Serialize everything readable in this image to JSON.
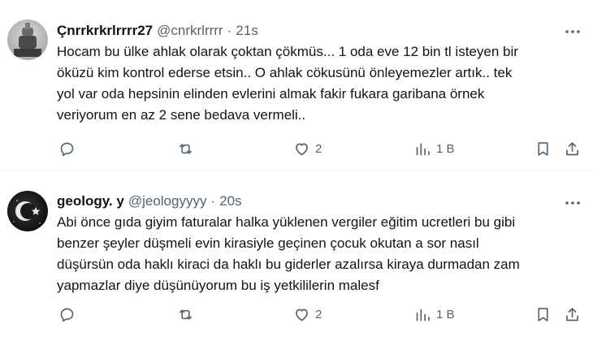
{
  "tweets": [
    {
      "display_name": "Çnrrkrkrlrrrr27",
      "handle": "@cnrkrlrrrr",
      "separator": "·",
      "time": "21s",
      "text": "Hocam bu ülke ahlak olarak çoktan çökmüs... 1 oda eve 12 bin tl isteyen bir\nöküzü kim kontrol ederse etsin..  O ahlak cökusünü önleyemezler artık..  tek\nyol var oda hepsinin elinden evlerini almak fakir fukara garibana örnek\nveriyorum en az 2 sene bedava vermeli..",
      "reply_count": "",
      "retweet_count": "",
      "like_count": "2",
      "view_count": "1 B"
    },
    {
      "display_name": "geology. y",
      "handle": "@jeologyyyy",
      "separator": "·",
      "time": "20s",
      "text": "Abi önce gıda giyim faturalar halka yüklenen vergiler eğitim ucretleri bu gibi\nbenzer şeyler düşmeli evin kirasiyle geçinen çocuk okutan a sor nasıl\ndüşürsün oda haklı kiraci da haklı bu giderler azalırsa kiraya durmadan zam\nyapmazlar diye düşünüyorum bu iş yetkililerin malesf",
      "reply_count": "",
      "retweet_count": "",
      "like_count": "2",
      "view_count": "1 B"
    }
  ],
  "icons": {
    "more": "more-dots-icon",
    "reply": "reply-icon",
    "retweet": "retweet-icon",
    "like": "heart-icon",
    "views": "views-icon",
    "bookmark": "bookmark-icon",
    "share": "share-icon"
  },
  "colors": {
    "text_primary": "#0f1419",
    "text_secondary": "#536471",
    "divider": "#eff3f4",
    "background": "#ffffff"
  }
}
